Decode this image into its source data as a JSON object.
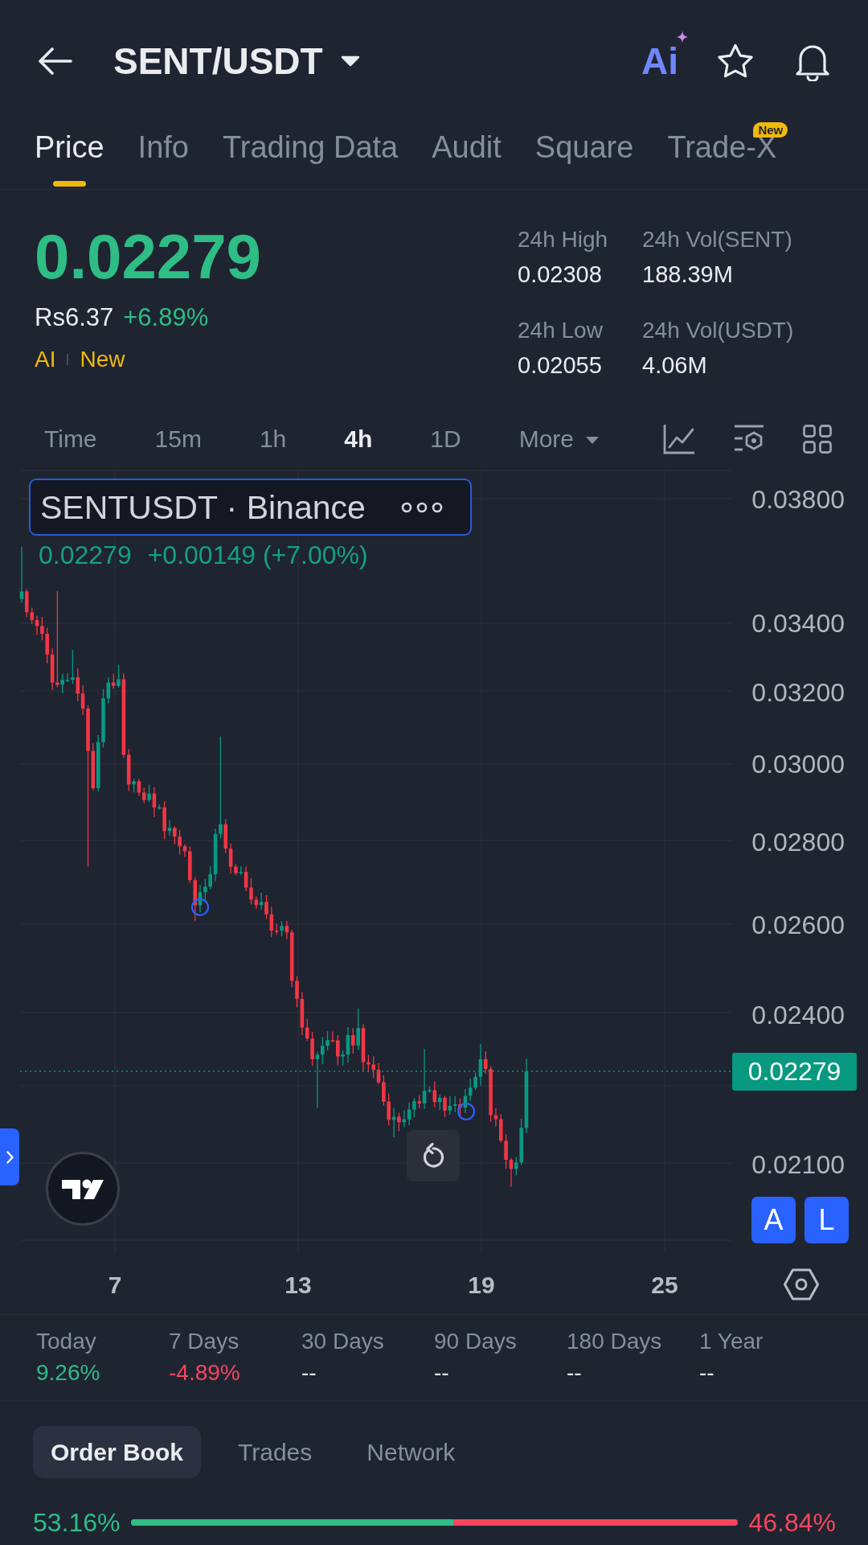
{
  "header": {
    "title": "SENT/USDT",
    "ai_label": "Ai"
  },
  "tabs": [
    {
      "label": "Price",
      "selected": true
    },
    {
      "label": "Info",
      "selected": false
    },
    {
      "label": "Trading Data",
      "selected": false
    },
    {
      "label": "Audit",
      "selected": false
    },
    {
      "label": "Square",
      "selected": false
    },
    {
      "label": "Trade-X",
      "selected": false,
      "badge": "New"
    }
  ],
  "ticker": {
    "price": "0.02279",
    "fiat_price": "Rs6.37",
    "change": "+6.89%",
    "tags": [
      "AI",
      "New"
    ]
  },
  "stats": [
    {
      "label": "24h High",
      "value": "0.02308"
    },
    {
      "label": "24h Vol(SENT)",
      "value": "188.39M"
    },
    {
      "label": "24h Low",
      "value": "0.02055"
    },
    {
      "label": "24h Vol(USDT)",
      "value": "4.06M"
    }
  ],
  "intervals": [
    {
      "label": "Time",
      "kind": "interval",
      "selected": false
    },
    {
      "label": "15m",
      "kind": "interval",
      "selected": false
    },
    {
      "label": "1h",
      "kind": "interval",
      "selected": false
    },
    {
      "label": "4h",
      "kind": "interval",
      "selected": true
    },
    {
      "label": "1D",
      "kind": "interval",
      "selected": false
    },
    {
      "label": "More",
      "kind": "menu",
      "selected": false
    }
  ],
  "chart": {
    "legend": {
      "symbol": "SENTUSDT · Binance",
      "last": "0.02279",
      "change": "+0.00149 (+7.00%)"
    },
    "price_axis": [
      "0.03800",
      "0.03400",
      "0.03200",
      "0.03000",
      "0.02800",
      "0.02600",
      "0.02400",
      "0.02100"
    ],
    "last_price_tag": "0.02279",
    "date_axis": [
      "7",
      "13",
      "19",
      "25"
    ],
    "buttons": [
      "A",
      "L"
    ]
  },
  "performance": [
    {
      "period": "Today",
      "value": "9.26%",
      "kind": "gain"
    },
    {
      "period": "7 Days",
      "value": "-4.89%",
      "kind": "loss"
    },
    {
      "period": "30 Days",
      "value": "--",
      "kind": "none"
    },
    {
      "period": "90 Days",
      "value": "--",
      "kind": "none"
    },
    {
      "period": "180 Days",
      "value": "--",
      "kind": "none"
    },
    {
      "period": "1 Year",
      "value": "--",
      "kind": "none"
    }
  ],
  "book_tabs": [
    {
      "label": "Order Book",
      "selected": true
    },
    {
      "label": "Trades",
      "selected": false
    },
    {
      "label": "Network",
      "selected": false
    }
  ],
  "order_ratio": {
    "buy": "53.16%",
    "sell": "46.84%",
    "level": 0.5316
  }
}
